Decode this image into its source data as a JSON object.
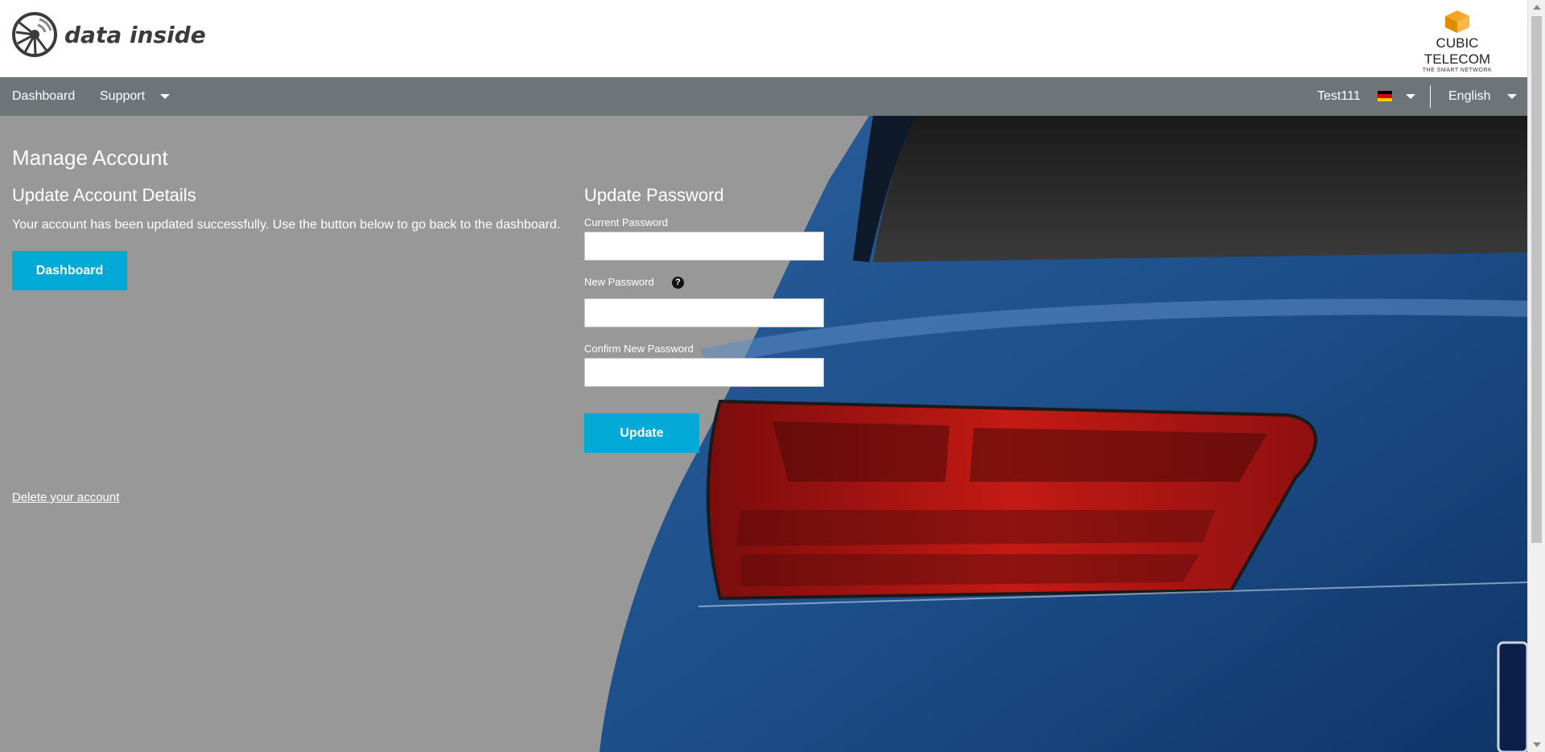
{
  "header": {
    "logo_text": "data inside",
    "partner_brand": "CUBIC TELECOM",
    "partner_tagline": "THE SMART NETWORK"
  },
  "nav": {
    "dashboard": "Dashboard",
    "support": "Support",
    "user": "Test111",
    "language": "English",
    "flag_colors": [
      "#000000",
      "#dd0000",
      "#ffce00"
    ]
  },
  "page": {
    "title": "Manage Account"
  },
  "account": {
    "heading": "Update Account Details",
    "message": "Your account has been updated successfully. Use the button below to go back to the dashboard.",
    "dashboard_button": "Dashboard",
    "delete_link": "Delete your account"
  },
  "password": {
    "heading": "Update Password",
    "current_label": "Current Password",
    "current_value": "",
    "new_label": "New Password",
    "new_value": "",
    "help_glyph": "?",
    "confirm_label": "Confirm New Password",
    "confirm_value": "",
    "update_button": "Update"
  },
  "colors": {
    "accent": "#00a9d6",
    "navbar": "#6d7579",
    "panel": "#989898"
  }
}
